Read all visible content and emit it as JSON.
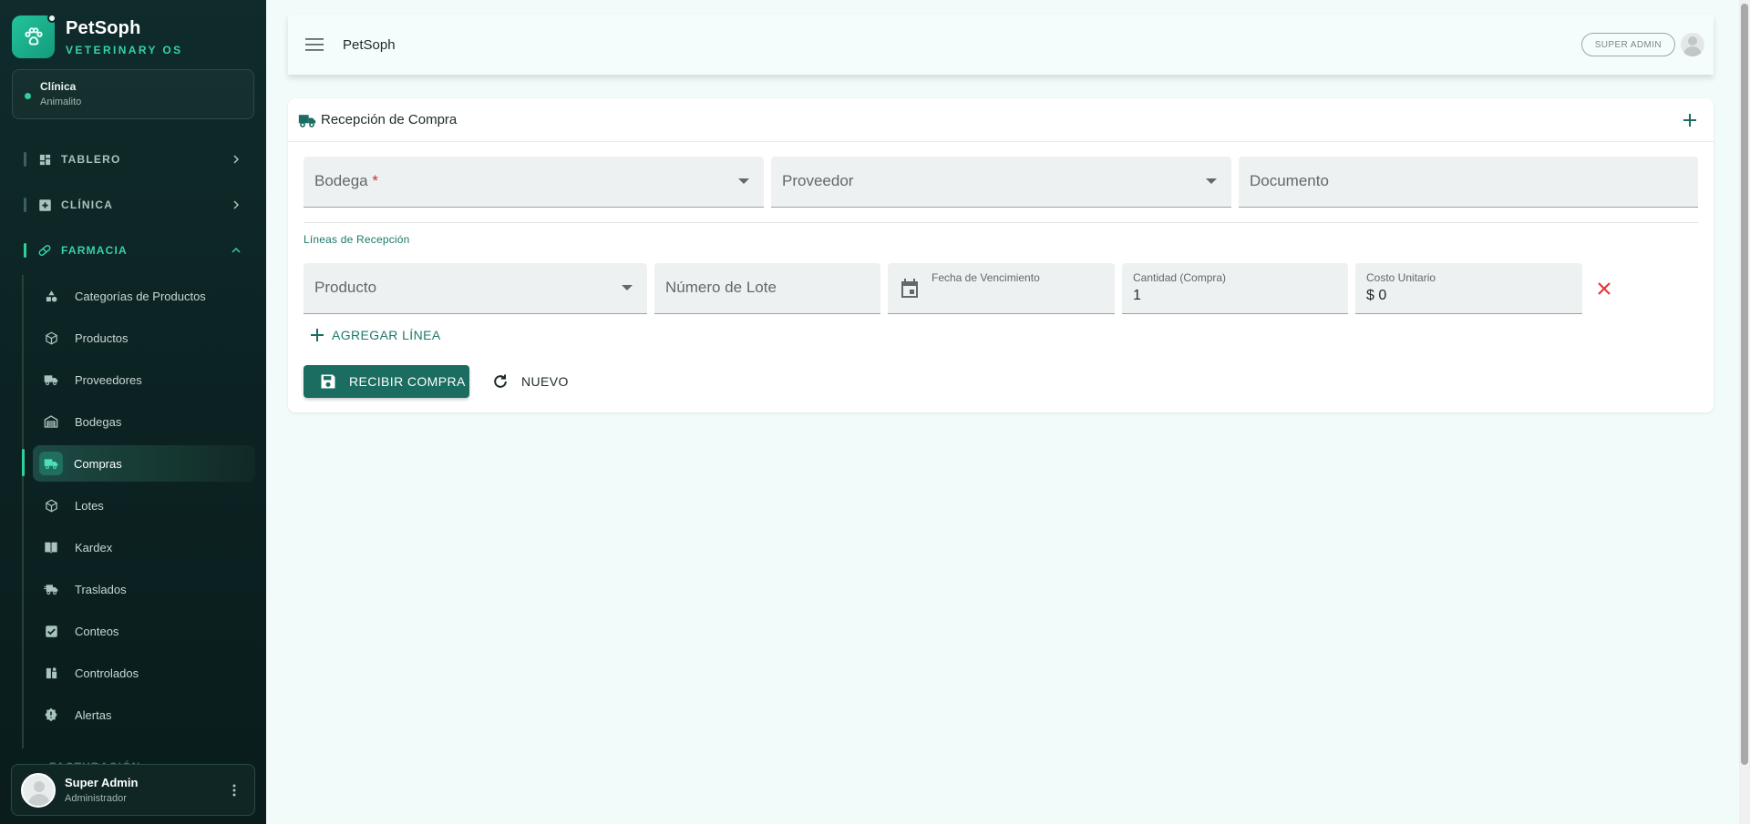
{
  "brand": {
    "name": "PetSoph",
    "subtitle": "VETERINARY OS"
  },
  "clinic": {
    "title": "Clínica",
    "name": "Animalito"
  },
  "nav": {
    "groups": [
      {
        "label": "TABLERO"
      },
      {
        "label": "CLÍNICA"
      },
      {
        "label": "FARMACIA"
      }
    ],
    "pharmacy_items": [
      {
        "label": "Categorías de Productos"
      },
      {
        "label": "Productos"
      },
      {
        "label": "Proveedores"
      },
      {
        "label": "Bodegas"
      },
      {
        "label": "Compras"
      },
      {
        "label": "Lotes"
      },
      {
        "label": "Kardex"
      },
      {
        "label": "Traslados"
      },
      {
        "label": "Conteos"
      },
      {
        "label": "Controlados"
      },
      {
        "label": "Alertas"
      }
    ],
    "next_group": "FACTURACIÓN",
    "active_item": "Compras"
  },
  "user": {
    "name": "Super Admin",
    "role": "Administrador"
  },
  "topbar": {
    "title": "PetSoph",
    "role_badge": "SUPER ADMIN"
  },
  "card": {
    "title": "Recepción de Compra"
  },
  "form": {
    "bodega_label": "Bodega",
    "bodega_required": "*",
    "proveedor_label": "Proveedor",
    "documento_label": "Documento",
    "lines_section": "Líneas de Recepción",
    "line": {
      "producto_label": "Producto",
      "lote_label": "Número de Lote",
      "vencimiento_label": "Fecha de Vencimiento",
      "cantidad_label": "Cantidad (Compra)",
      "cantidad_value": "1",
      "costo_label": "Costo Unitario",
      "costo_value": "$ 0"
    },
    "add_line_label": "AGREGAR LÍNEA",
    "submit_label": "RECIBIR COMPRA",
    "reset_label": "NUEVO"
  },
  "colors": {
    "accent": "#1a6d60",
    "brand": "#22c49c",
    "danger": "#e53935"
  }
}
